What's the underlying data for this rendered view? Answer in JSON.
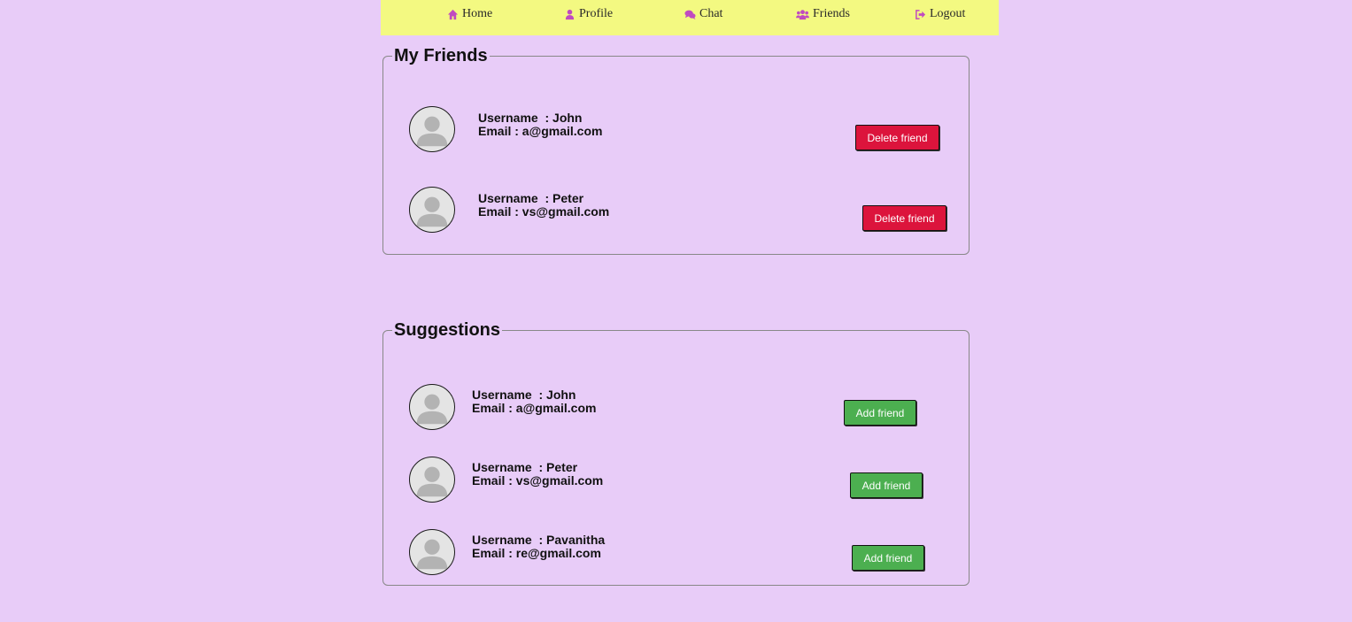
{
  "nav": {
    "items": [
      {
        "label": "Home",
        "icon": "home-icon"
      },
      {
        "label": "Profile",
        "icon": "user-icon"
      },
      {
        "label": "Chat",
        "icon": "comments-icon"
      },
      {
        "label": "Friends",
        "icon": "users-icon"
      },
      {
        "label": "Logout",
        "icon": "sign-out-icon"
      }
    ],
    "icon_color": "#c04bc0"
  },
  "friends": {
    "title": "My Friends",
    "items": [
      {
        "username": "Username  : John",
        "email": "Email : a@gmail.com",
        "button": "Delete friend"
      },
      {
        "username": "Username  : Peter",
        "email": "Email : vs@gmail.com",
        "button": "Delete friend"
      }
    ]
  },
  "suggestions": {
    "title": "Suggestions",
    "items": [
      {
        "username": "Username  : John",
        "email": "Email : a@gmail.com",
        "button": "Add friend"
      },
      {
        "username": "Username  : Peter",
        "email": "Email : vs@gmail.com",
        "button": "Add friend"
      },
      {
        "username": "Username  : Pavanitha",
        "email": "Email : re@gmail.com",
        "button": "Add friend"
      }
    ]
  },
  "colors": {
    "background": "#e8ccf8",
    "navbar": "#f3f981",
    "delete_button": "#dc143c",
    "add_button": "#4caf50"
  }
}
